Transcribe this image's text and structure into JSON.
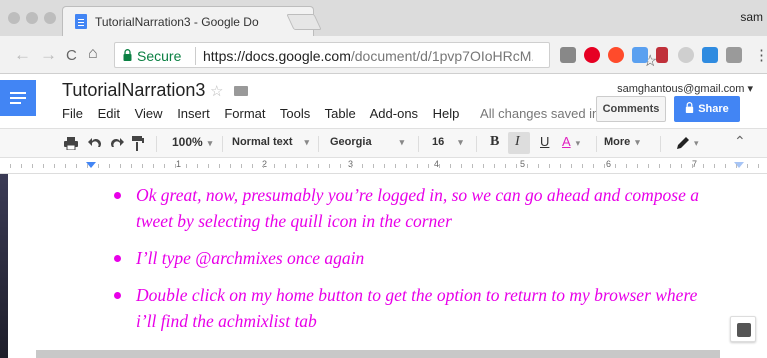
{
  "browser": {
    "tab_title": "TutorialNarration3 - Google Do",
    "tab_close": "×",
    "profile_name": "sam",
    "secure_label": "Secure",
    "url_domain": "https://docs.google.com",
    "url_path": "/document/d/1pvp7OIoHRcM...",
    "nav": {
      "back": "←",
      "forward": "→",
      "reload": "C",
      "home": "⌂"
    },
    "star": "☆",
    "extensions": [
      "extension-icon",
      "pinterest-icon",
      "opera-icon",
      "document-icon",
      "bars-icon",
      "cloud-icon",
      "image-icon",
      "camera-icon"
    ],
    "menu_dots": "⋮"
  },
  "docs": {
    "title": "TutorialNarration3",
    "title_star": "☆",
    "account_email": "samghantous@gmail.com ▾",
    "menu": [
      "File",
      "Edit",
      "View",
      "Insert",
      "Format",
      "Tools",
      "Table",
      "Add-ons",
      "Help"
    ],
    "saved_status": "All changes saved in Dr...",
    "comments_label": "Comments",
    "share_label": "Share"
  },
  "format_toolbar": {
    "zoom": "100%",
    "style": "Normal text",
    "font": "Georgia",
    "size": "16",
    "bold": "B",
    "italic": "I",
    "underline": "U",
    "text_color": "A",
    "more": "More",
    "caret": "▾",
    "collapse": "⌃"
  },
  "ruler": {
    "numbers": [
      "1",
      "2",
      "3",
      "4",
      "5",
      "6",
      "7"
    ]
  },
  "document": {
    "text_color": "#e800e8",
    "bullets": [
      "Ok great, now, presumably you’re logged in, so we can go ahead and compose a tweet by selecting the quill icon in the corner",
      "I’ll type @archmixes once again",
      "Double click on my home button to get the option to return to my browser where i’ll find the achmixlist tab"
    ]
  },
  "colors": {
    "accent": "#4285f4",
    "secure_green": "#0b8043",
    "doc_text": "#e800e8"
  }
}
